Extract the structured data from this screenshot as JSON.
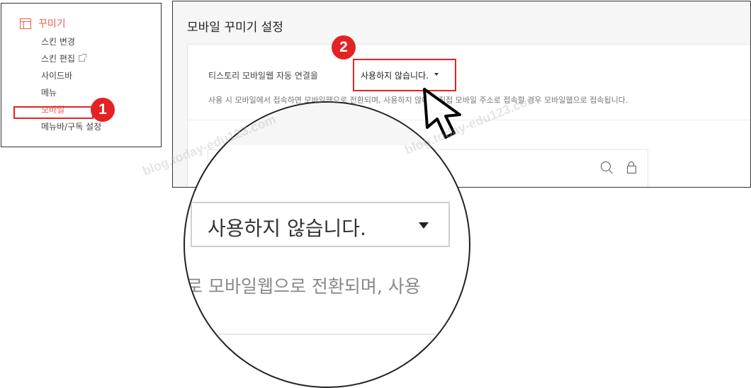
{
  "menu": {
    "title": "꾸미기",
    "items": [
      {
        "label": "스킨 변경"
      },
      {
        "label": "스킨 편집",
        "external": true
      },
      {
        "label": "사이드바"
      },
      {
        "label": "메뉴"
      },
      {
        "label": "모바일",
        "active": true
      },
      {
        "label": "메뉴바/구독 설정"
      }
    ]
  },
  "badges": {
    "first": "1",
    "second": "2"
  },
  "settings": {
    "title": "모바일 꾸미기 설정",
    "auto_link_label": "티스토리 모바일웹 자동 연결을",
    "select_value": "사용하지 않습니다.",
    "help_text": "사용 시 모바일에서 접속하면 모바일웹으로 전환되며, 사용하지 않아도 직접 모바일 주소로 접속할 경우 모바일웹으로 접속됩니다."
  },
  "magnifier": {
    "select_value": "사용하지 않습니다.",
    "help_fragment": "로 모바일웹으로 전환되며, 사용"
  },
  "watermark": "blog.today-edu123.com",
  "colors": {
    "accent": "#e8614b",
    "highlight": "#e32323"
  }
}
